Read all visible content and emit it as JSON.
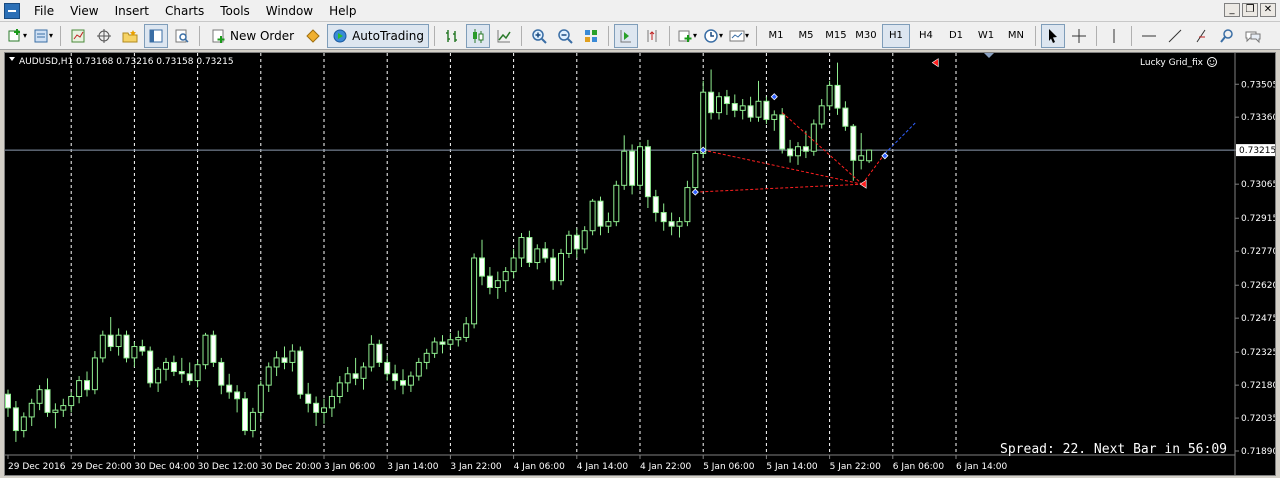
{
  "menu": {
    "items": [
      {
        "label": "File"
      },
      {
        "label": "View"
      },
      {
        "label": "Insert"
      },
      {
        "label": "Charts"
      },
      {
        "label": "Tools"
      },
      {
        "label": "Window"
      },
      {
        "label": "Help"
      }
    ]
  },
  "window_controls": {
    "minimize": "_",
    "restore": "❐",
    "close": "✕"
  },
  "toolbar": {
    "new_order_label": "New Order",
    "autotrading_label": "AutoTrading",
    "timeframes": [
      "M1",
      "M5",
      "M15",
      "M30",
      "H1",
      "H4",
      "D1",
      "W1",
      "MN"
    ],
    "active_timeframe": "H1"
  },
  "chart": {
    "header": "AUDUSD,H1  0.73168 0.73216 0.73158 0.73215",
    "indicator": "Lucky Grid_fix",
    "bid_label": "0.73215",
    "status_text": "Spread: 22. Next Bar in 56:09",
    "background": "#000000",
    "bull_color": "#90ee90",
    "bear_color": "#ffffff",
    "grid_color": "#ffffff",
    "bid_line_color": "#8c9bb0",
    "order_line_color": "#ff2020"
  },
  "chart_data": {
    "type": "candlestick",
    "symbol": "AUDUSD",
    "timeframe": "H1",
    "ylim": [
      0.7189,
      0.73625
    ],
    "y_ticks": [
      "0.73505",
      "0.73360",
      "0.73215",
      "0.73065",
      "0.72915",
      "0.72770",
      "0.72620",
      "0.72475",
      "0.72325",
      "0.72180",
      "0.72035",
      "0.71890"
    ],
    "x_ticks": [
      "29 Dec 2016",
      "29 Dec 20:00",
      "30 Dec 04:00",
      "30 Dec 12:00",
      "30 Dec 20:00",
      "3 Jan 06:00",
      "3 Jan 14:00",
      "3 Jan 22:00",
      "4 Jan 06:00",
      "4 Jan 14:00",
      "4 Jan 22:00",
      "5 Jan 06:00",
      "5 Jan 14:00",
      "5 Jan 22:00",
      "6 Jan 06:00",
      "6 Jan 14:00"
    ],
    "bid": 0.73215,
    "candles": [
      [
        0.7214,
        0.7216,
        0.7204,
        0.7208
      ],
      [
        0.7208,
        0.7211,
        0.7193,
        0.7198
      ],
      [
        0.7198,
        0.7206,
        0.7195,
        0.7204
      ],
      [
        0.7204,
        0.7212,
        0.72,
        0.721
      ],
      [
        0.721,
        0.7218,
        0.7207,
        0.7216
      ],
      [
        0.7216,
        0.7221,
        0.7204,
        0.7206
      ],
      [
        0.7206,
        0.721,
        0.7199,
        0.7207
      ],
      [
        0.7207,
        0.7212,
        0.7204,
        0.7209
      ],
      [
        0.7209,
        0.7215,
        0.7206,
        0.7213
      ],
      [
        0.7213,
        0.7222,
        0.721,
        0.722
      ],
      [
        0.722,
        0.7224,
        0.7213,
        0.7216
      ],
      [
        0.7216,
        0.7233,
        0.7214,
        0.723
      ],
      [
        0.723,
        0.7242,
        0.7228,
        0.724
      ],
      [
        0.724,
        0.7248,
        0.7233,
        0.7235
      ],
      [
        0.7235,
        0.7243,
        0.7231,
        0.724
      ],
      [
        0.724,
        0.7242,
        0.7228,
        0.723
      ],
      [
        0.723,
        0.7237,
        0.7226,
        0.7235
      ],
      [
        0.7235,
        0.7238,
        0.7231,
        0.7233
      ],
      [
        0.7233,
        0.7235,
        0.7217,
        0.7219
      ],
      [
        0.7219,
        0.7226,
        0.7215,
        0.7225
      ],
      [
        0.7225,
        0.723,
        0.722,
        0.7228
      ],
      [
        0.7228,
        0.7231,
        0.7222,
        0.7224
      ],
      [
        0.7224,
        0.723,
        0.7219,
        0.7223
      ],
      [
        0.7223,
        0.7228,
        0.7218,
        0.722
      ],
      [
        0.722,
        0.7229,
        0.7217,
        0.7227
      ],
      [
        0.7227,
        0.7241,
        0.7225,
        0.724
      ],
      [
        0.724,
        0.7242,
        0.7226,
        0.7228
      ],
      [
        0.7228,
        0.723,
        0.7214,
        0.7218
      ],
      [
        0.7218,
        0.7223,
        0.7212,
        0.7215
      ],
      [
        0.7215,
        0.7218,
        0.7206,
        0.7212
      ],
      [
        0.7212,
        0.7215,
        0.7196,
        0.7198
      ],
      [
        0.7198,
        0.7208,
        0.7195,
        0.7206
      ],
      [
        0.7206,
        0.722,
        0.7203,
        0.7218
      ],
      [
        0.7218,
        0.7228,
        0.7215,
        0.7226
      ],
      [
        0.7226,
        0.7233,
        0.7222,
        0.723
      ],
      [
        0.723,
        0.7235,
        0.7225,
        0.7228
      ],
      [
        0.7228,
        0.7236,
        0.7224,
        0.7233
      ],
      [
        0.7233,
        0.7235,
        0.7212,
        0.7214
      ],
      [
        0.7214,
        0.7219,
        0.7206,
        0.721
      ],
      [
        0.721,
        0.7213,
        0.72,
        0.7206
      ],
      [
        0.7206,
        0.7212,
        0.7201,
        0.7208
      ],
      [
        0.7208,
        0.7216,
        0.7204,
        0.7213
      ],
      [
        0.7213,
        0.7222,
        0.721,
        0.7219
      ],
      [
        0.7219,
        0.7226,
        0.7215,
        0.7223
      ],
      [
        0.7223,
        0.723,
        0.7218,
        0.7221
      ],
      [
        0.7221,
        0.7228,
        0.7216,
        0.7226
      ],
      [
        0.7226,
        0.724,
        0.7224,
        0.7236
      ],
      [
        0.7236,
        0.7238,
        0.7226,
        0.7228
      ],
      [
        0.7228,
        0.7231,
        0.722,
        0.7223
      ],
      [
        0.7223,
        0.7227,
        0.7216,
        0.722
      ],
      [
        0.722,
        0.7225,
        0.7214,
        0.7218
      ],
      [
        0.7218,
        0.7224,
        0.7215,
        0.7222
      ],
      [
        0.7222,
        0.723,
        0.722,
        0.7228
      ],
      [
        0.7228,
        0.7234,
        0.7225,
        0.7232
      ],
      [
        0.7232,
        0.7239,
        0.723,
        0.7237
      ],
      [
        0.7237,
        0.724,
        0.7232,
        0.7236
      ],
      [
        0.7236,
        0.7241,
        0.7234,
        0.7238
      ],
      [
        0.7238,
        0.7242,
        0.7235,
        0.7239
      ],
      [
        0.7239,
        0.7248,
        0.7237,
        0.7245
      ],
      [
        0.7245,
        0.7276,
        0.7243,
        0.7274
      ],
      [
        0.7274,
        0.7282,
        0.7262,
        0.7266
      ],
      [
        0.7266,
        0.727,
        0.7258,
        0.7261
      ],
      [
        0.7261,
        0.7268,
        0.7256,
        0.7264
      ],
      [
        0.7264,
        0.727,
        0.7259,
        0.7268
      ],
      [
        0.7268,
        0.7278,
        0.7265,
        0.7274
      ],
      [
        0.7274,
        0.7285,
        0.727,
        0.7283
      ],
      [
        0.7283,
        0.7286,
        0.727,
        0.7272
      ],
      [
        0.7272,
        0.728,
        0.7269,
        0.7278
      ],
      [
        0.7278,
        0.7281,
        0.7272,
        0.7274
      ],
      [
        0.7274,
        0.7278,
        0.726,
        0.7264
      ],
      [
        0.7264,
        0.7278,
        0.7262,
        0.7276
      ],
      [
        0.7276,
        0.7286,
        0.7274,
        0.7284
      ],
      [
        0.7284,
        0.7287,
        0.7274,
        0.7278
      ],
      [
        0.7278,
        0.7288,
        0.7276,
        0.7286
      ],
      [
        0.7286,
        0.73,
        0.7284,
        0.7299
      ],
      [
        0.7299,
        0.7301,
        0.7284,
        0.7288
      ],
      [
        0.7288,
        0.7294,
        0.7285,
        0.729
      ],
      [
        0.729,
        0.7308,
        0.7288,
        0.7306
      ],
      [
        0.7306,
        0.7328,
        0.7304,
        0.7321
      ],
      [
        0.7321,
        0.7324,
        0.7302,
        0.7306
      ],
      [
        0.7306,
        0.7325,
        0.7304,
        0.7323
      ],
      [
        0.7323,
        0.7326,
        0.7296,
        0.7301
      ],
      [
        0.7301,
        0.7304,
        0.729,
        0.7294
      ],
      [
        0.7294,
        0.7298,
        0.7286,
        0.729
      ],
      [
        0.729,
        0.7294,
        0.7284,
        0.7288
      ],
      [
        0.7288,
        0.7292,
        0.7283,
        0.729
      ],
      [
        0.729,
        0.7308,
        0.7288,
        0.7305
      ],
      [
        0.7305,
        0.7321,
        0.7303,
        0.732
      ],
      [
        0.732,
        0.7352,
        0.7318,
        0.7347
      ],
      [
        0.7347,
        0.7357,
        0.7335,
        0.7338
      ],
      [
        0.7338,
        0.7347,
        0.7335,
        0.7345
      ],
      [
        0.7345,
        0.7348,
        0.7337,
        0.7342
      ],
      [
        0.7342,
        0.7346,
        0.7336,
        0.7339
      ],
      [
        0.7339,
        0.7344,
        0.7335,
        0.7341
      ],
      [
        0.7341,
        0.7345,
        0.7334,
        0.7336
      ],
      [
        0.7336,
        0.7352,
        0.7334,
        0.7343
      ],
      [
        0.7343,
        0.7345,
        0.7333,
        0.7335
      ],
      [
        0.7335,
        0.7339,
        0.733,
        0.7337
      ],
      [
        0.7337,
        0.734,
        0.732,
        0.7322
      ],
      [
        0.7322,
        0.7326,
        0.7316,
        0.7319
      ],
      [
        0.7319,
        0.7325,
        0.7315,
        0.7323
      ],
      [
        0.7323,
        0.733,
        0.7318,
        0.7321
      ],
      [
        0.7321,
        0.7335,
        0.7319,
        0.7333
      ],
      [
        0.7333,
        0.7344,
        0.7331,
        0.7341
      ],
      [
        0.7341,
        0.7352,
        0.7339,
        0.735
      ],
      [
        0.735,
        0.736,
        0.7337,
        0.734
      ],
      [
        0.734,
        0.7343,
        0.733,
        0.7332
      ],
      [
        0.7332,
        0.7333,
        0.7308,
        0.7317
      ],
      [
        0.7317,
        0.7329,
        0.7313,
        0.7319
      ],
      [
        0.73168,
        0.73216,
        0.73158,
        0.73215
      ]
    ]
  }
}
